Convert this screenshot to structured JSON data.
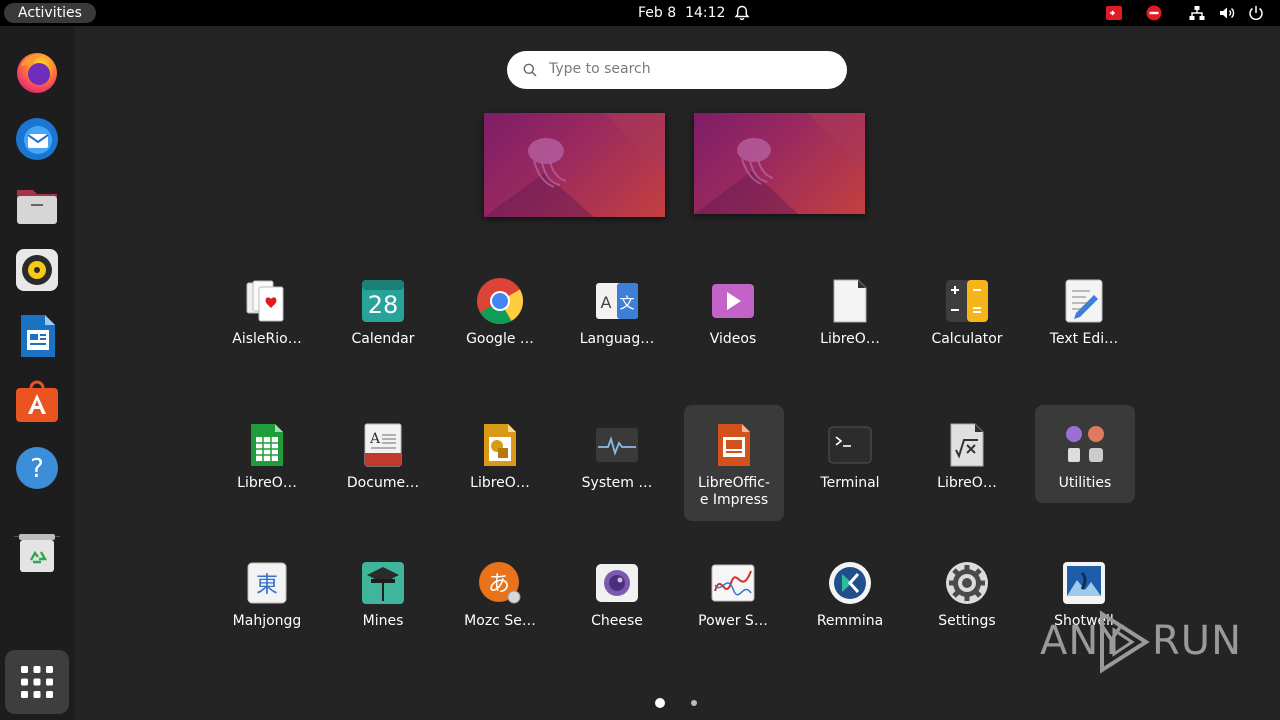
{
  "topbar": {
    "activities": "Activities",
    "date": "Feb 8",
    "time": "14:12"
  },
  "dock": {
    "items": [
      "firefox-icon",
      "thunderbird-icon",
      "files-icon",
      "rhythmbox-icon",
      "libreoffice-writer-icon",
      "app-center-icon",
      "help-icon",
      "trash-icon",
      "show-apps-icon"
    ]
  },
  "search": {
    "placeholder": "Type to search"
  },
  "apps": [
    {
      "label": "AisleRio…",
      "icon": "aisleriot-cards-icon"
    },
    {
      "label": "Calendar",
      "icon": "calendar-icon",
      "badge": "28"
    },
    {
      "label": "Google …",
      "icon": "chrome-icon"
    },
    {
      "label": "Languag…",
      "icon": "language-icon",
      "glyph_a": "A",
      "glyph_b": "文"
    },
    {
      "label": "Videos",
      "icon": "videos-icon"
    },
    {
      "label": "LibreO…",
      "icon": "libreoffice-icon"
    },
    {
      "label": "Calculator",
      "icon": "calculator-icon"
    },
    {
      "label": "Text Edi…",
      "icon": "text-editor-icon"
    },
    {
      "label": "LibreO…",
      "icon": "libreoffice-calc-icon"
    },
    {
      "label": "Docume…",
      "icon": "document-viewer-icon"
    },
    {
      "label": "LibreO…",
      "icon": "libreoffice-draw-icon"
    },
    {
      "label": "System …",
      "icon": "system-monitor-icon"
    },
    {
      "label": "LibreOffic-e Impress",
      "line1": "LibreOffic-",
      "line2": "e Impress",
      "icon": "libreoffice-impress-icon",
      "selected": true
    },
    {
      "label": "Terminal",
      "icon": "terminal-icon"
    },
    {
      "label": "LibreO…",
      "icon": "libreoffice-math-icon"
    },
    {
      "label": "Utilities",
      "icon": "utilities-folder-icon",
      "folder": true
    },
    {
      "label": "Mahjongg",
      "icon": "mahjongg-icon",
      "glyph": "東"
    },
    {
      "label": "Mines",
      "icon": "mines-icon"
    },
    {
      "label": "Mozc Se…",
      "icon": "mozc-icon",
      "glyph": "あ"
    },
    {
      "label": "Cheese",
      "icon": "cheese-icon"
    },
    {
      "label": "Power S…",
      "icon": "power-statistics-icon"
    },
    {
      "label": "Remmina",
      "icon": "remmina-icon"
    },
    {
      "label": "Settings",
      "icon": "settings-icon"
    },
    {
      "label": "Shotwell",
      "icon": "shotwell-icon"
    }
  ],
  "pager": {
    "pages": 2,
    "current": 1
  },
  "watermark": {
    "text_left": "ANY",
    "text_right": "RUN"
  }
}
